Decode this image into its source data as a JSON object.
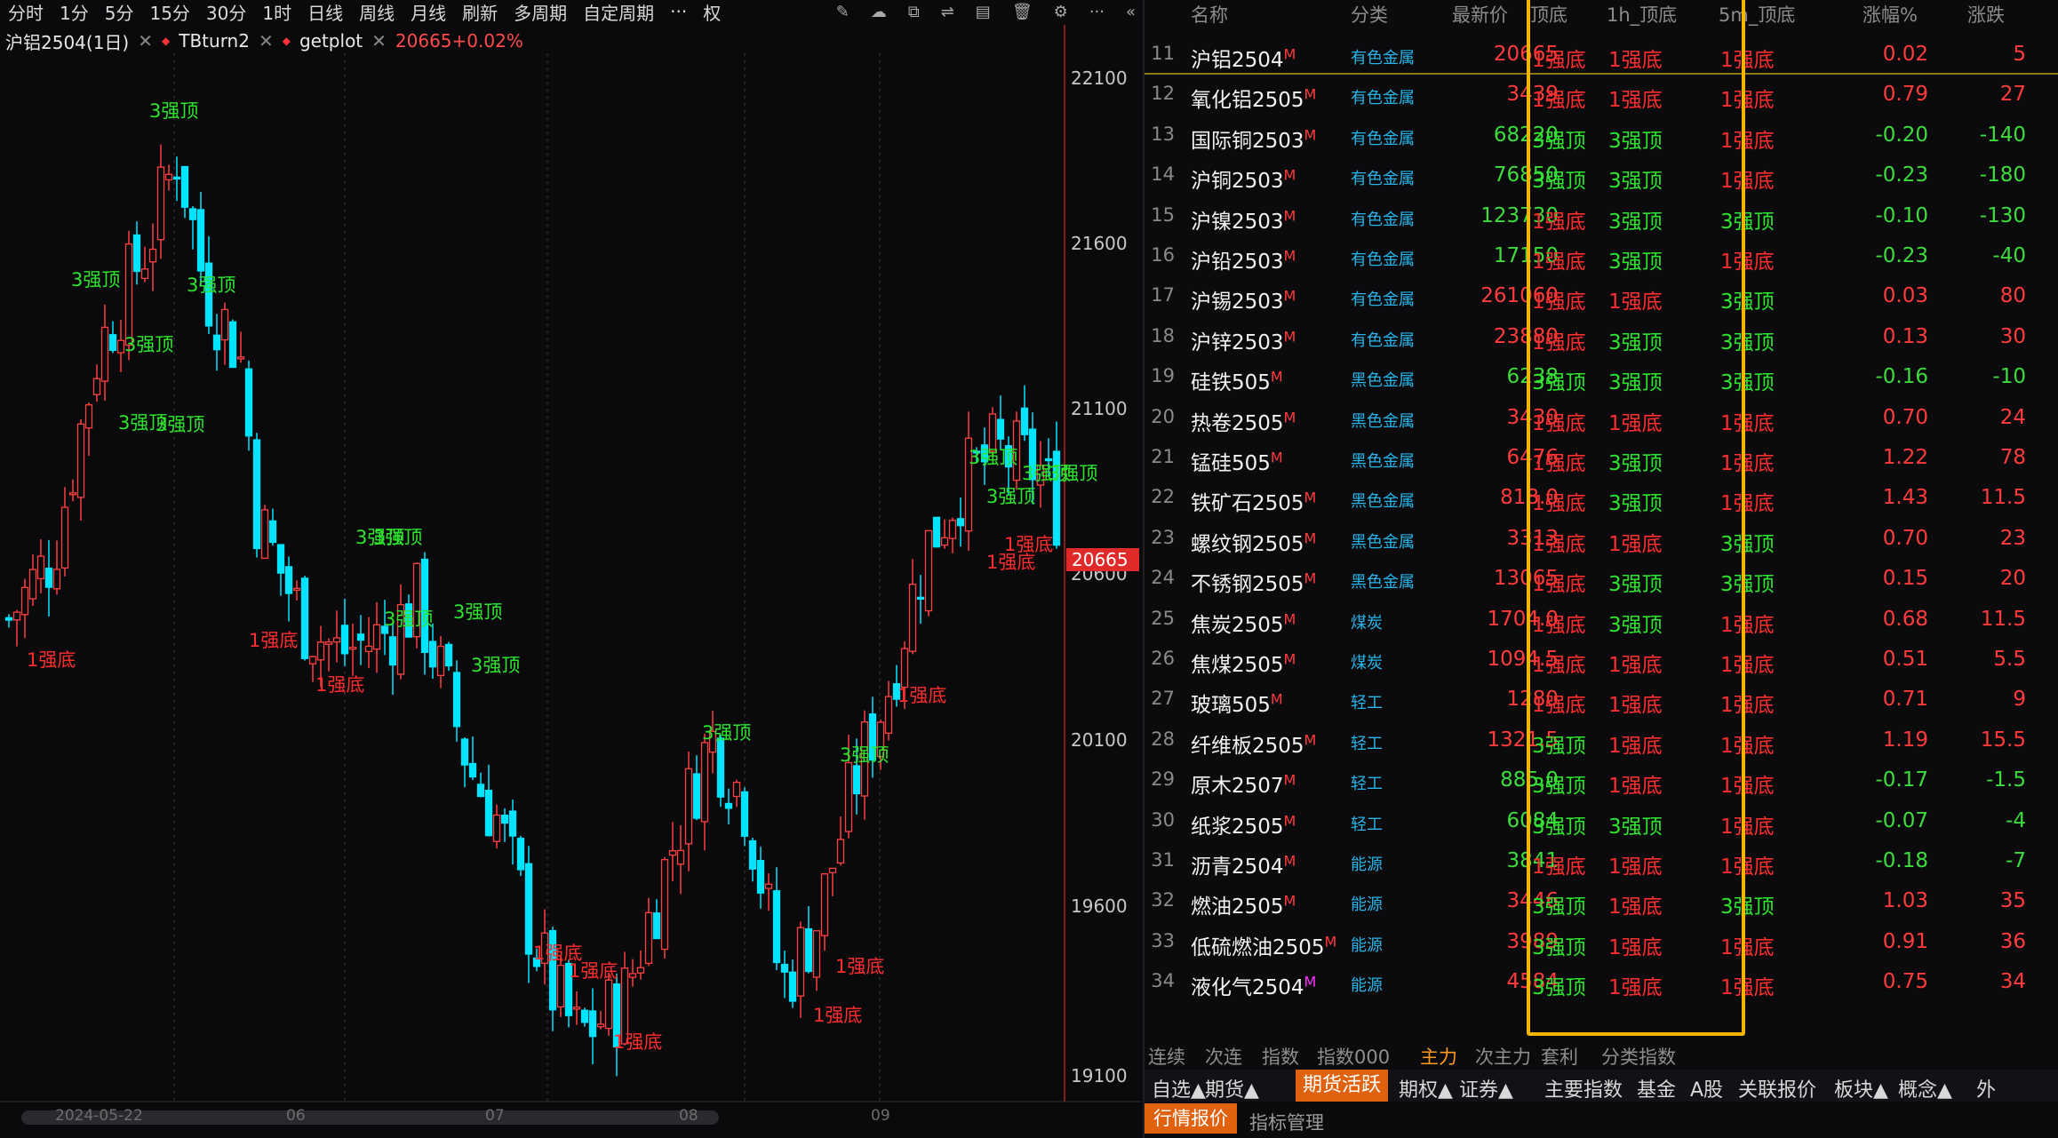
{
  "toolbar": {
    "items": [
      "分时",
      "1分",
      "5分",
      "15分",
      "30分",
      "1时",
      "日线",
      "周线",
      "月线",
      "刷新",
      "多周期",
      "自定周期",
      "···",
      "权"
    ]
  },
  "legend": {
    "main": "沪铝2504(1日)",
    "ind1": "TBturn2",
    "ind2": "getplot",
    "price": "20665+0.02%"
  },
  "axis": {
    "ticks": [
      "22100",
      "21600",
      "21100",
      "20600",
      "20100",
      "19600",
      "19100"
    ],
    "current": "20665",
    "dates": [
      "2024-05-22",
      "06",
      "07",
      "08",
      "09"
    ]
  },
  "chart_annotations": [
    {
      "text": "3强顶",
      "type": "top"
    },
    {
      "text": "3强顶",
      "type": "top"
    },
    {
      "text": "3强顶",
      "type": "top"
    },
    {
      "text": "3强顶",
      "type": "top"
    },
    {
      "text": "3强顶",
      "type": "top"
    },
    {
      "text": "3强顶",
      "type": "top"
    },
    {
      "text": "3强顶",
      "type": "top"
    },
    {
      "text": "3强顶",
      "type": "top"
    },
    {
      "text": "3强顶",
      "type": "top"
    },
    {
      "text": "3强顶",
      "type": "top"
    },
    {
      "text": "3强顶",
      "type": "top"
    },
    {
      "text": "3强顶",
      "type": "top"
    },
    {
      "text": "3强顶",
      "type": "top"
    },
    {
      "text": "3强顶",
      "type": "top"
    },
    {
      "text": "3强顶",
      "type": "top"
    },
    {
      "text": "3强顶",
      "type": "top"
    },
    {
      "text": "3强顶",
      "type": "top"
    },
    {
      "text": "1强底",
      "type": "bottom"
    },
    {
      "text": "1强底",
      "type": "bottom"
    },
    {
      "text": "1强底",
      "type": "bottom"
    },
    {
      "text": "1强底",
      "type": "bottom"
    },
    {
      "text": "1强底",
      "type": "bottom"
    },
    {
      "text": "1强底",
      "type": "bottom"
    },
    {
      "text": "1强底",
      "type": "bottom"
    },
    {
      "text": "1强底",
      "type": "bottom"
    },
    {
      "text": "1强底",
      "type": "bottom"
    },
    {
      "text": "1强底",
      "type": "bottom"
    },
    {
      "text": "1强底",
      "type": "bottom"
    }
  ],
  "table": {
    "headers": [
      "名称",
      "分类",
      "最新价",
      "顶底",
      "1h_顶底",
      "5m_顶底",
      "涨幅%",
      "涨跌"
    ],
    "rows": [
      {
        "idx": "11",
        "name": "沪铝2504",
        "mark": "M",
        "cat": "有色金属",
        "price": "20665",
        "t1": "1强底",
        "t2": "1强底",
        "t3": "1强底",
        "pct": "0.02",
        "chg": "5"
      },
      {
        "idx": "12",
        "name": "氧化铝2505",
        "mark": "M",
        "cat": "有色金属",
        "price": "3439",
        "t1": "1强底",
        "t2": "1强底",
        "t3": "1强底",
        "pct": "0.79",
        "chg": "27"
      },
      {
        "idx": "13",
        "name": "国际铜2503",
        "mark": "M",
        "cat": "有色金属",
        "price": "68220",
        "t1": "3强顶",
        "t2": "3强顶",
        "t3": "1强底",
        "pct": "-0.20",
        "chg": "-140"
      },
      {
        "idx": "14",
        "name": "沪铜2503",
        "mark": "M",
        "cat": "有色金属",
        "price": "76850",
        "t1": "3强顶",
        "t2": "3强顶",
        "t3": "1强底",
        "pct": "-0.23",
        "chg": "-180"
      },
      {
        "idx": "15",
        "name": "沪镍2503",
        "mark": "M",
        "cat": "有色金属",
        "price": "123730",
        "t1": "1强底",
        "t2": "3强顶",
        "t3": "3强顶",
        "pct": "-0.10",
        "chg": "-130"
      },
      {
        "idx": "16",
        "name": "沪铅2503",
        "mark": "M",
        "cat": "有色金属",
        "price": "17150",
        "t1": "1强底",
        "t2": "3强顶",
        "t3": "1强底",
        "pct": "-0.23",
        "chg": "-40"
      },
      {
        "idx": "17",
        "name": "沪锡2503",
        "mark": "M",
        "cat": "有色金属",
        "price": "261060",
        "t1": "1强底",
        "t2": "1强底",
        "t3": "3强顶",
        "pct": "0.03",
        "chg": "80"
      },
      {
        "idx": "18",
        "name": "沪锌2503",
        "mark": "M",
        "cat": "有色金属",
        "price": "23880",
        "t1": "1强底",
        "t2": "3强顶",
        "t3": "3强顶",
        "pct": "0.13",
        "chg": "30"
      },
      {
        "idx": "19",
        "name": "硅铁505",
        "mark": "M",
        "cat": "黑色金属",
        "price": "6238",
        "t1": "3强顶",
        "t2": "3强顶",
        "t3": "3强顶",
        "pct": "-0.16",
        "chg": "-10"
      },
      {
        "idx": "20",
        "name": "热卷2505",
        "mark": "M",
        "cat": "黑色金属",
        "price": "3430",
        "t1": "1强底",
        "t2": "1强底",
        "t3": "1强底",
        "pct": "0.70",
        "chg": "24"
      },
      {
        "idx": "21",
        "name": "锰硅505",
        "mark": "M",
        "cat": "黑色金属",
        "price": "6476",
        "t1": "1强底",
        "t2": "3强顶",
        "t3": "1强底",
        "pct": "1.22",
        "chg": "78"
      },
      {
        "idx": "22",
        "name": "铁矿石2505",
        "mark": "M",
        "cat": "黑色金属",
        "price": "818.0",
        "t1": "1强底",
        "t2": "3强顶",
        "t3": "1强底",
        "pct": "1.43",
        "chg": "11.5"
      },
      {
        "idx": "23",
        "name": "螺纹钢2505",
        "mark": "M",
        "cat": "黑色金属",
        "price": "3313",
        "t1": "1强底",
        "t2": "1强底",
        "t3": "3强顶",
        "pct": "0.70",
        "chg": "23"
      },
      {
        "idx": "24",
        "name": "不锈钢2505",
        "mark": "M",
        "cat": "黑色金属",
        "price": "13065",
        "t1": "1强底",
        "t2": "3强顶",
        "t3": "3强顶",
        "pct": "0.15",
        "chg": "20"
      },
      {
        "idx": "25",
        "name": "焦炭2505",
        "mark": "M",
        "cat": "煤炭",
        "price": "1704.0",
        "t1": "1强底",
        "t2": "3强顶",
        "t3": "1强底",
        "pct": "0.68",
        "chg": "11.5"
      },
      {
        "idx": "26",
        "name": "焦煤2505",
        "mark": "M",
        "cat": "煤炭",
        "price": "1094.5",
        "t1": "1强底",
        "t2": "1强底",
        "t3": "1强底",
        "pct": "0.51",
        "chg": "5.5"
      },
      {
        "idx": "27",
        "name": "玻璃505",
        "mark": "M",
        "cat": "轻工",
        "price": "1280",
        "t1": "1强底",
        "t2": "1强底",
        "t3": "1强底",
        "pct": "0.71",
        "chg": "9"
      },
      {
        "idx": "28",
        "name": "纤维板2505",
        "mark": "M",
        "cat": "轻工",
        "price": "1321.5",
        "t1": "3强顶",
        "t2": "1强底",
        "t3": "1强底",
        "pct": "1.19",
        "chg": "15.5"
      },
      {
        "idx": "29",
        "name": "原木2507",
        "mark": "M",
        "cat": "轻工",
        "price": "885.0",
        "t1": "3强顶",
        "t2": "1强底",
        "t3": "1强底",
        "pct": "-0.17",
        "chg": "-1.5"
      },
      {
        "idx": "30",
        "name": "纸浆2505",
        "mark": "M",
        "cat": "轻工",
        "price": "6084",
        "t1": "3强顶",
        "t2": "3强顶",
        "t3": "1强底",
        "pct": "-0.07",
        "chg": "-4"
      },
      {
        "idx": "31",
        "name": "沥青2504",
        "mark": "M",
        "cat": "能源",
        "price": "3841",
        "t1": "1强底",
        "t2": "1强底",
        "t3": "1强底",
        "pct": "-0.18",
        "chg": "-7"
      },
      {
        "idx": "32",
        "name": "燃油2505",
        "mark": "M",
        "cat": "能源",
        "price": "3446",
        "t1": "3强顶",
        "t2": "1强底",
        "t3": "3强顶",
        "pct": "1.03",
        "chg": "35"
      },
      {
        "idx": "33",
        "name": "低硫燃油2505",
        "mark": "M",
        "cat": "能源",
        "price": "3989",
        "t1": "3强顶",
        "t2": "1强底",
        "t3": "1强底",
        "pct": "0.91",
        "chg": "36"
      },
      {
        "idx": "34",
        "name": "液化气2504",
        "mark": "M",
        "cat": "能源",
        "price": "4584",
        "t1": "3强顶",
        "t2": "1强底",
        "t3": "1强底",
        "pct": "0.75",
        "chg": "34"
      }
    ]
  },
  "tabs": [
    "连续",
    "次连",
    "指数",
    "指数000",
    "主力",
    "次主力",
    "套利",
    "分类指数"
  ],
  "active_tab": "主力",
  "market_bar": [
    "自选▲",
    "期货▲",
    "期货活跃",
    "期权▲",
    "证券▲",
    "主要指数",
    "基金",
    "A股",
    "关联报价",
    "板块▲",
    "概念▲",
    "外"
  ],
  "sub_bar": [
    "行情报价",
    "指标管理"
  ],
  "colors": {
    "up": "#ff3b3b",
    "down": "#3ddc3d",
    "candle_down": "#00e5ff",
    "accent": "#e0620f",
    "box": "#f5b400"
  }
}
